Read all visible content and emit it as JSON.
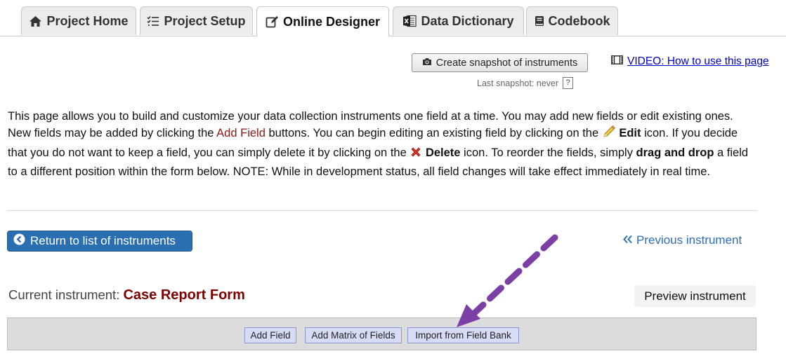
{
  "tabs": [
    {
      "label": "Project Home",
      "icon": "home-icon"
    },
    {
      "label": "Project Setup",
      "icon": "checklist-icon"
    },
    {
      "label": "Online Designer",
      "icon": "edit-icon",
      "active": true
    },
    {
      "label": "Data Dictionary",
      "icon": "excel-icon"
    },
    {
      "label": "Codebook",
      "icon": "book-icon"
    }
  ],
  "snapshot": {
    "button_label": "Create snapshot of instruments",
    "last_label": "Last snapshot: never",
    "help": "?"
  },
  "video": {
    "label": "VIDEO: How to use this page"
  },
  "intro": {
    "p1": "This page allows you to build and customize your data collection instruments one field at a time. You may add new fields or edit existing ones. New fields may be added by clicking the ",
    "add_field": "Add Field",
    "p2": " buttons. You can begin editing an existing field by clicking on the ",
    "edit": "Edit",
    "p3": " icon. If you decide that you do not want to keep a field, you can simply delete it by clicking on the ",
    "delete": "Delete",
    "p4": " icon. To reorder the fields, simply ",
    "drag": "drag and drop",
    "p5": " a field to a different position within the form below. NOTE: While in development status, all field changes will take effect immediately in real time."
  },
  "nav": {
    "return_label": "Return to list of instruments",
    "previous_label": "Previous instrument"
  },
  "current": {
    "prefix": "Current instrument:",
    "name": "Case Report Form",
    "preview_label": "Preview instrument"
  },
  "field_buttons": {
    "add_field": "Add Field",
    "add_matrix": "Add Matrix of Fields",
    "import_bank": "Import from Field Bank"
  },
  "colors": {
    "accent_blue": "#2b6fb3",
    "instrument_name": "#800000",
    "annotation_arrow": "#7b3fa6"
  }
}
